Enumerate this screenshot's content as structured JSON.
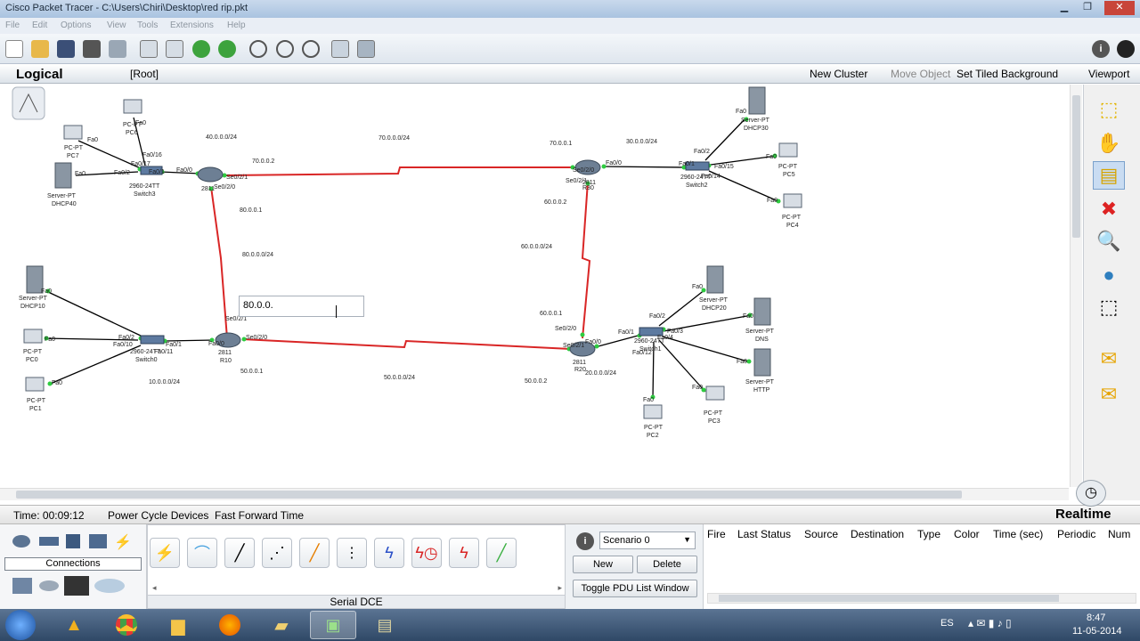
{
  "window": {
    "title": "Cisco Packet Tracer - C:\\Users\\Chiri\\Desktop\\red rip.pkt"
  },
  "menu": [
    "File",
    "Edit",
    "Options",
    "View",
    "Tools",
    "Extensions",
    "Help"
  ],
  "logical_bar": {
    "logical": "Logical",
    "root": "[Root]",
    "new_cluster": "New Cluster",
    "move_object": "Move Object",
    "set_tiled_background": "Set Tiled Background",
    "viewport": "Viewport"
  },
  "canvas": {
    "edit_text": "80.0.0.",
    "networks": [
      "40.0.0.0/24",
      "70.0.0.0/24",
      "30.0.0.0/24",
      "80.0.0.0/24",
      "60.0.0.0/24",
      "10.0.0.0/24",
      "50.0.0.0/24",
      "20.0.0.0/24"
    ],
    "ips": [
      "70.0.0.2",
      "70.0.0.1",
      "80.0.0.1",
      "60.0.0.2",
      "60.0.0.1",
      "50.0.0.1",
      "50.0.0.2"
    ],
    "devices": {
      "pc7": "PC-PT\nPC7",
      "pc6": "PC-PT\nPC6",
      "dhcp40": "Server-PT\nDHCP40",
      "switch3": "2960-24TT\nSwitch3",
      "r40": "2811\nR40",
      "r30": "2811\nR30",
      "switch2": "2960-24TT\nSwitch2",
      "dhcp30": "Server-PT\nDHCP30",
      "pc5": "PC-PT\nPC5",
      "pc4": "PC-PT\nPC4",
      "dhcp10": "Server-PT\nDHCP10",
      "pc0": "PC-PT\nPC0",
      "pc1": "PC-PT\nPC1",
      "switch0": "2960-24TT\nSwitch0",
      "r10": "2811\nR10",
      "r20": "2811\nR20",
      "switch1": "2960-24TT\nSwitch1",
      "dhcp20": "Server-PT\nDHCP20",
      "dns": "Server-PT\nDNS",
      "http": "Server-PT\nHTTP",
      "pc2": "PC-PT\nPC2",
      "pc3": "PC-PT\nPC3"
    }
  },
  "status": {
    "time": "Time: 00:09:12",
    "power_cycle": "Power Cycle Devices",
    "fast_forward": "Fast Forward Time",
    "mode": "Realtime"
  },
  "device_panel": {
    "category": "Connections"
  },
  "cable_panel": {
    "selected_label": "Serial DCE"
  },
  "scenario": {
    "selected": "Scenario 0",
    "new": "New",
    "delete": "Delete",
    "toggle": "Toggle PDU List Window"
  },
  "pdu_table": {
    "columns": [
      "Fire",
      "Last Status",
      "Source",
      "Destination",
      "Type",
      "Color",
      "Time (sec)",
      "Periodic",
      "Num"
    ]
  },
  "taskbar": {
    "lang": "ES",
    "time": "8:47",
    "date": "11-05-2014"
  },
  "colors": {
    "serial_link": "#d92626",
    "ethernet_link": "#000000",
    "port_up": "#2ecc40",
    "accent": "#3a6ea5"
  }
}
